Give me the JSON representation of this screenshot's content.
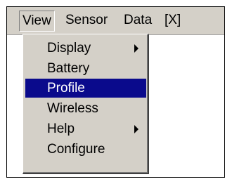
{
  "menubar": {
    "items": [
      {
        "label": "View"
      },
      {
        "label": "Sensor"
      },
      {
        "label": "Data"
      },
      {
        "label": "[X]"
      }
    ]
  },
  "view_menu": {
    "items": [
      {
        "label": "Display",
        "submenu": true,
        "icon": "submenu-arrow-icon"
      },
      {
        "label": "Battery"
      },
      {
        "label": "Profile",
        "selected": true
      },
      {
        "label": "Wireless"
      },
      {
        "label": "Help",
        "submenu": true,
        "icon": "submenu-arrow-icon"
      },
      {
        "label": "Configure"
      }
    ]
  },
  "colors": {
    "menu_background": "#d4d0c8",
    "selection_background": "#0a0a8c",
    "selection_text": "#ffffff"
  }
}
